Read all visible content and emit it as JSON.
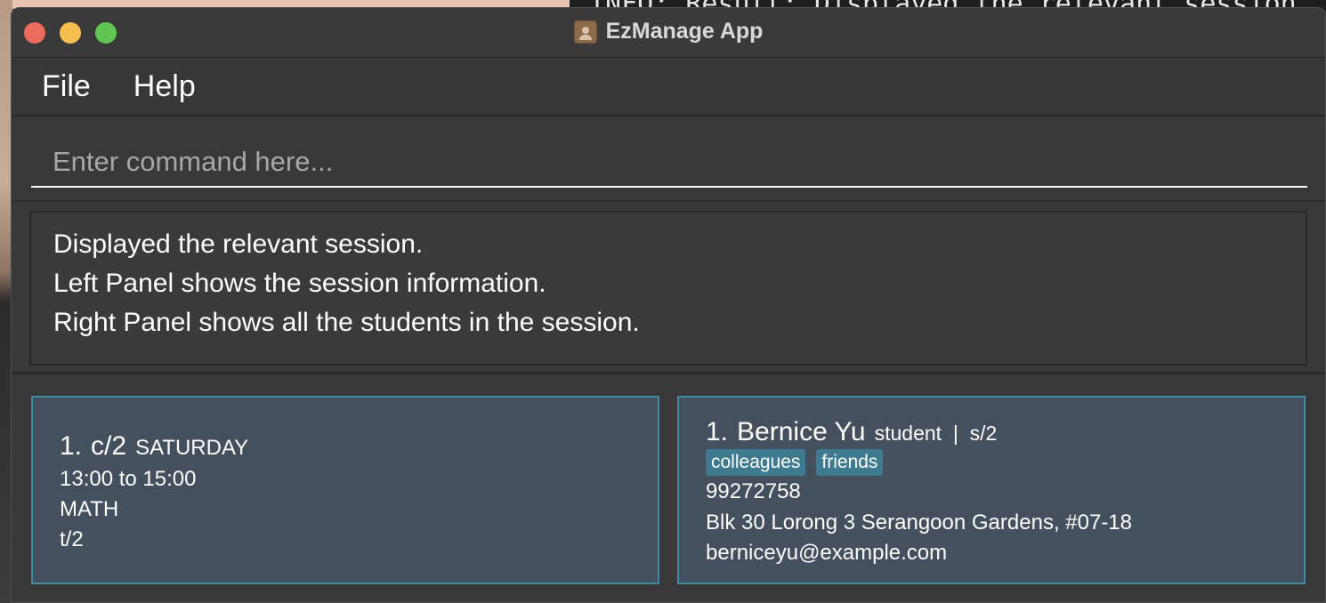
{
  "background_terminal_text": "INFO: Result: Displayed the relevant session",
  "window": {
    "title": "EzManage App"
  },
  "menu": {
    "items": [
      "File",
      "Help"
    ]
  },
  "command": {
    "placeholder": "Enter command here...",
    "value": ""
  },
  "result": {
    "lines": [
      "Displayed the relevant session.",
      "Left Panel shows the session information.",
      "Right Panel shows all the students in the session."
    ]
  },
  "session_card": {
    "index": "1.",
    "code": "c/2",
    "day": "SATURDAY",
    "time": "13:00 to 15:00",
    "subject": "MATH",
    "tutor": "t/2"
  },
  "student_card": {
    "index": "1.",
    "name": "Bernice Yu",
    "meta": "student  |  s/2",
    "tags": [
      "colleagues",
      "friends"
    ],
    "phone": "99272758",
    "address": "Blk 30 Lorong 3 Serangoon Gardens, #07-18",
    "email": "berniceyu@example.com"
  },
  "colors": {
    "card_background": "#45505f",
    "card_border": "#3f8a9e",
    "tag_background": "#3e7b91",
    "window_background": "#3b3b3b"
  }
}
